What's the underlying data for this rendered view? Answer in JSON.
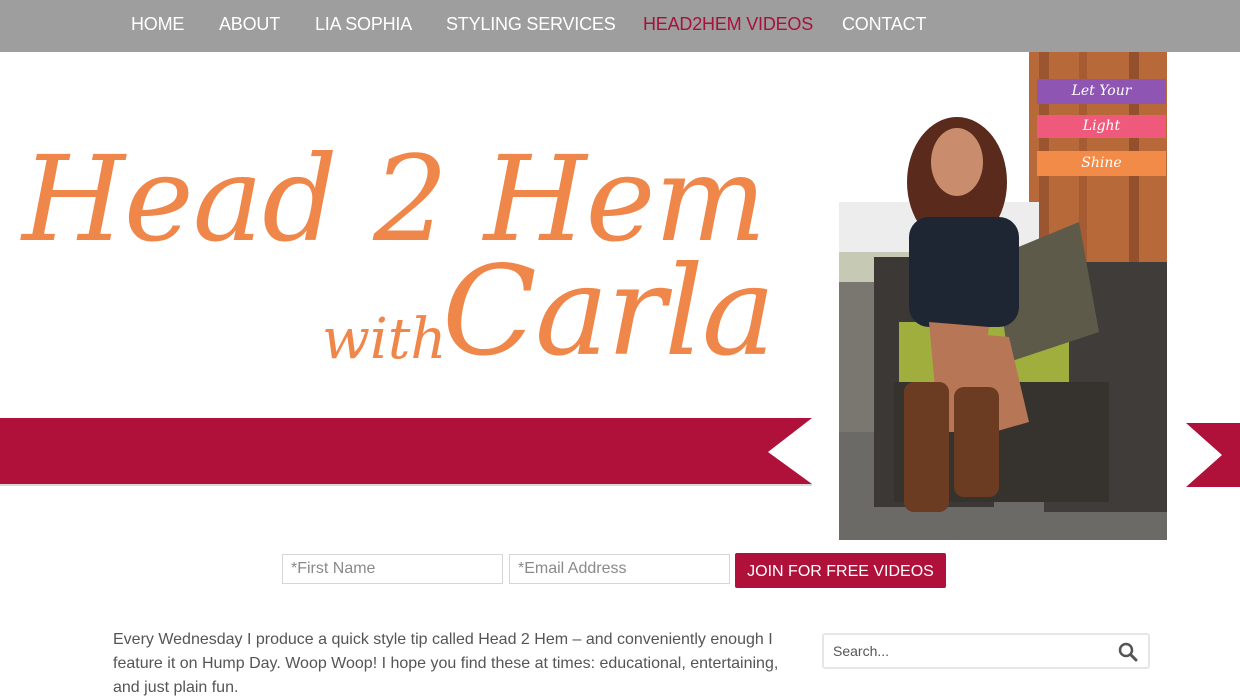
{
  "nav": {
    "items": [
      {
        "label": "HOME"
      },
      {
        "label": "ABOUT"
      },
      {
        "label": "LIA SOPHIA"
      },
      {
        "label": "STYLING SERVICES"
      },
      {
        "label": "HEAD2HEM VIDEOS"
      },
      {
        "label": "CONTACT"
      }
    ],
    "active_index": 4,
    "active_color": "#a8113a",
    "background": "#9e9e9e"
  },
  "hero": {
    "title_line1": "Head 2 Hem",
    "title_with": "with",
    "title_name": "Carla",
    "title_color": "#f0874a",
    "ribbon_color": "#b0113b",
    "tags": [
      "Let Your",
      "Light",
      "Shine"
    ]
  },
  "signup": {
    "first_name_placeholder": "*First Name",
    "email_placeholder": "*Email Address",
    "button_label": "JOIN FOR FREE VIDEOS"
  },
  "content": {
    "intro": "Every Wednesday I produce a quick style tip called Head 2 Hem – and conveniently enough I feature it on Hump Day. Woop Woop! I hope you find these at times: educational, entertaining, and just plain fun."
  },
  "search": {
    "placeholder": "Search...",
    "icon": "search-icon"
  }
}
